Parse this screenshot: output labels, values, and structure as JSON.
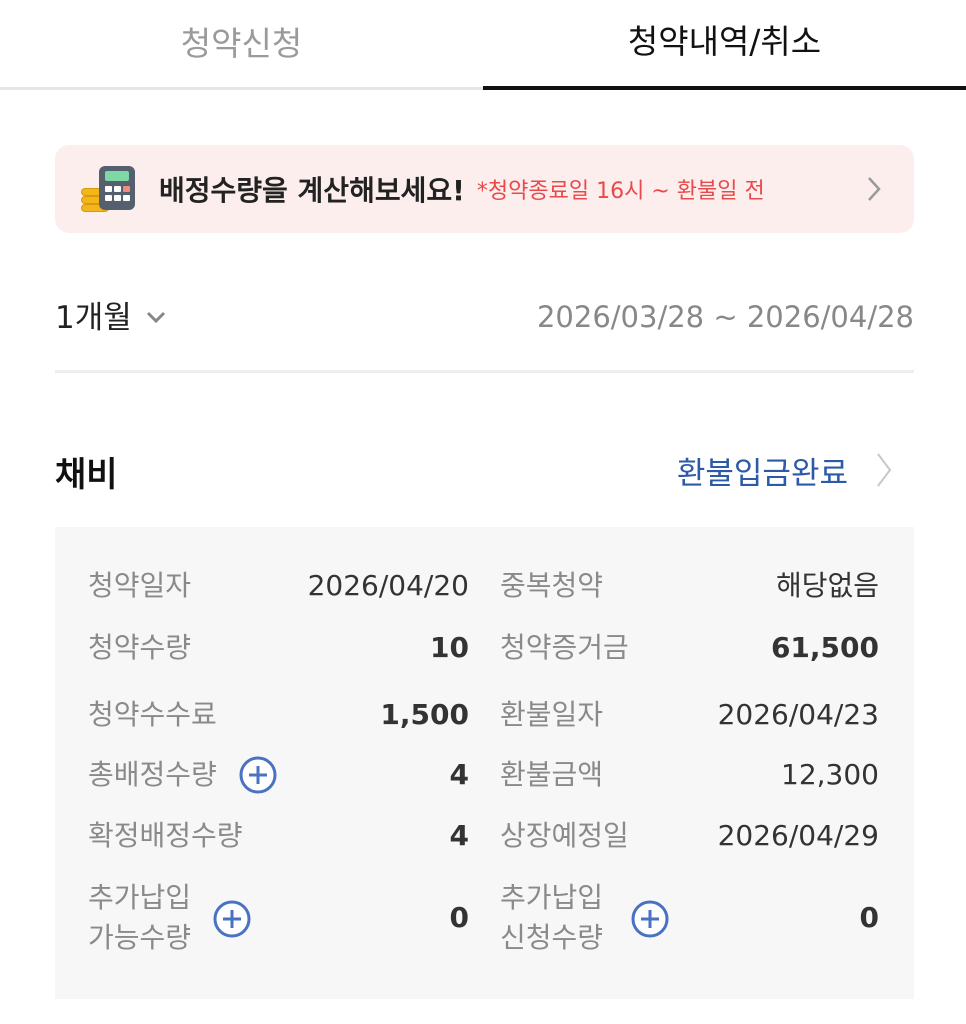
{
  "tabs": [
    {
      "label": "청약신청",
      "active": false
    },
    {
      "label": "청약내역/취소",
      "active": true
    }
  ],
  "banner": {
    "title": "배정수량을 계산해보세요!",
    "note": "*청약종료일 16시 ~ 환불일 전",
    "note_color": "#e8494a",
    "background": "#fdeeee"
  },
  "filter": {
    "period": "1개월",
    "date_range": "2026/03/28 ~ 2026/04/28"
  },
  "item": {
    "name": "채비",
    "status": "환불입금완료",
    "status_color": "#2c5aa8"
  },
  "details": {
    "subscription_date_label": "청약일자",
    "subscription_date_value": "2026/04/20",
    "duplicate_label": "중복청약",
    "duplicate_value": "해당없음",
    "quantity_label": "청약수량",
    "quantity_value": "10",
    "deposit_label": "청약증거금",
    "deposit_value": "61,500",
    "fee_label": "청약수수료",
    "fee_value": "1,500",
    "refund_date_label": "환불일자",
    "refund_date_value": "2026/04/23",
    "total_alloc_label": "총배정수량",
    "total_alloc_value": "4",
    "refund_amount_label": "환불금액",
    "refund_amount_value": "12,300",
    "confirmed_alloc_label": "확정배정수량",
    "confirmed_alloc_value": "4",
    "listing_date_label": "상장예정일",
    "listing_date_value": "2026/04/29",
    "extra_available_label_1": "추가납입",
    "extra_available_label_2": "가능수량",
    "extra_available_value": "0",
    "extra_request_label_1": "추가납입",
    "extra_request_label_2": "신청수량",
    "extra_request_value": "0"
  },
  "icons": {
    "banner": "calculator-coins-icon",
    "banner_arrow": "chevron-right-icon",
    "period": "chevron-down-icon",
    "status_arrow": "chevron-right-icon",
    "expand": "plus-circle-icon"
  }
}
